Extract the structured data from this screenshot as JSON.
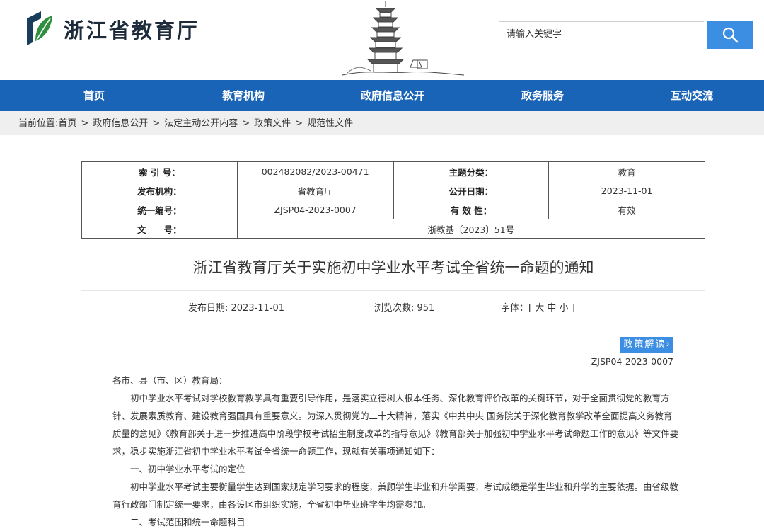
{
  "header": {
    "site_name": "浙江省教育厅",
    "search_placeholder": "请输入关键字"
  },
  "nav": [
    "首页",
    "教育机构",
    "政府信息公开",
    "政务服务",
    "互动交流"
  ],
  "breadcrumb": {
    "prefix": "当前位置:",
    "items": [
      "首页",
      "政府信息公开",
      "法定主动公开内容",
      "政策文件",
      "规范性文件"
    ],
    "separator": ">"
  },
  "meta_table": {
    "index_label": "索 引 号：",
    "index_value": "002482082/2023-00471",
    "topic_label": "主题分类：",
    "topic_value": "教育",
    "publisher_label": "发布机构：",
    "publisher_value": "省教育厅",
    "date_label": "公开日期：",
    "date_value": "2023-11-01",
    "serial_label": "统一编号：",
    "serial_value": "ZJSP04-2023-0007",
    "validity_label": "有 效 性：",
    "validity_value": "有效",
    "docno_label": "文　　号：",
    "docno_value": "浙教基〔2023〕51号"
  },
  "article": {
    "title": "浙江省教育厅关于实施初中学业水平考试全省统一命题的通知",
    "publish_date": "发布日期: 2023-11-01",
    "views": "浏览次数: 951",
    "font_label": "字体：[",
    "font_large": "大",
    "font_medium": "中",
    "font_small": "小",
    "font_close": "]",
    "policy_button": "政策解读",
    "doc_code": "ZJSP04-2023-0007",
    "paragraphs": [
      "各市、县（市、区）教育局：",
      "初中学业水平考试对学校教育教学具有重要引导作用，是落实立德树人根本任务、深化教育评价改革的关键环节，对于全面贯彻党的教育方针、发展素质教育、建设教育强国具有重要意义。为深入贯彻党的二十大精神，落实《中共中央 国务院关于深化教育教学改革全面提高义务教育质量的意见》《教育部关于进一步推进高中阶段学校考试招生制度改革的指导意见》《教育部关于加强初中学业水平考试命题工作的意见》等文件要求，稳步实施浙江省初中学业水平考试全省统一命题工作，现就有关事项通知如下：",
      "一、初中学业水平考试的定位",
      "初中学业水平考试主要衡量学生达到国家规定学习要求的程度，兼顾学生毕业和升学需要，考试成绩是学生毕业和升学的主要依据。由省级教育行政部门制定统一要求，由各设区市组织实施，全省初中毕业班学生均需参加。",
      "二、考试范围和统一命题科目"
    ]
  }
}
